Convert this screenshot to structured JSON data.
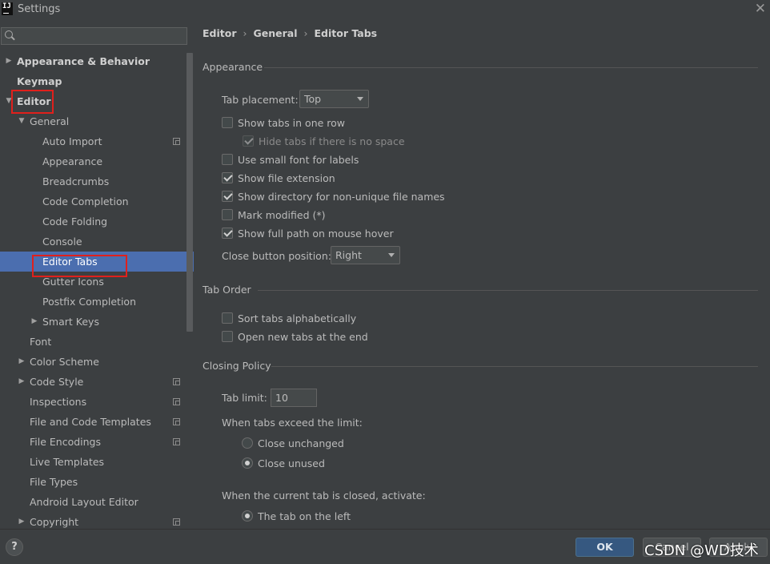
{
  "window": {
    "title": "Settings",
    "logo": "IJ"
  },
  "search": {
    "placeholder": "",
    "value": ""
  },
  "sidebar": {
    "items": [
      {
        "label": "Appearance & Behavior",
        "level": 0,
        "arrow": "▶",
        "bold": true
      },
      {
        "label": "Keymap",
        "level": 0,
        "arrow": "",
        "bold": true
      },
      {
        "label": "Editor",
        "level": 0,
        "arrow": "▼",
        "bold": true
      },
      {
        "label": "General",
        "level": 1,
        "arrow": "▼"
      },
      {
        "label": "Auto Import",
        "level": 2,
        "arrow": "",
        "copy_icon": true
      },
      {
        "label": "Appearance",
        "level": 2,
        "arrow": ""
      },
      {
        "label": "Breadcrumbs",
        "level": 2,
        "arrow": ""
      },
      {
        "label": "Code Completion",
        "level": 2,
        "arrow": ""
      },
      {
        "label": "Code Folding",
        "level": 2,
        "arrow": ""
      },
      {
        "label": "Console",
        "level": 2,
        "arrow": ""
      },
      {
        "label": "Editor Tabs",
        "level": 2,
        "arrow": "",
        "selected": true
      },
      {
        "label": "Gutter Icons",
        "level": 2,
        "arrow": ""
      },
      {
        "label": "Postfix Completion",
        "level": 2,
        "arrow": ""
      },
      {
        "label": "Smart Keys",
        "level": 2,
        "arrow": "▶"
      },
      {
        "label": "Font",
        "level": 1,
        "arrow": ""
      },
      {
        "label": "Color Scheme",
        "level": 1,
        "arrow": "▶"
      },
      {
        "label": "Code Style",
        "level": 1,
        "arrow": "▶",
        "copy_icon": true
      },
      {
        "label": "Inspections",
        "level": 1,
        "arrow": "",
        "copy_icon": true
      },
      {
        "label": "File and Code Templates",
        "level": 1,
        "arrow": "",
        "copy_icon": true
      },
      {
        "label": "File Encodings",
        "level": 1,
        "arrow": "",
        "copy_icon": true
      },
      {
        "label": "Live Templates",
        "level": 1,
        "arrow": ""
      },
      {
        "label": "File Types",
        "level": 1,
        "arrow": ""
      },
      {
        "label": "Android Layout Editor",
        "level": 1,
        "arrow": ""
      },
      {
        "label": "Copyright",
        "level": 1,
        "arrow": "▶",
        "copy_icon": true
      }
    ]
  },
  "breadcrumb": [
    "Editor",
    "General",
    "Editor Tabs"
  ],
  "breadcrumb_separator": "›",
  "appearance": {
    "title": "Appearance",
    "tab_placement_label": "Tab placement:",
    "tab_placement_value": "Top",
    "show_tabs_one_row": {
      "label": "Show tabs in one row",
      "checked": false
    },
    "hide_tabs_no_space": {
      "label": "Hide tabs if there is no space",
      "checked": true,
      "disabled": true
    },
    "small_font": {
      "label": "Use small font for labels",
      "checked": false
    },
    "show_extension": {
      "label": "Show file extension",
      "checked": true
    },
    "show_directory": {
      "label": "Show directory for non-unique file names",
      "checked": true
    },
    "mark_modified": {
      "label": "Mark modified (*)",
      "checked": false
    },
    "full_path_hover": {
      "label": "Show full path on mouse hover",
      "checked": true
    },
    "close_button_label": "Close button position:",
    "close_button_value": "Right"
  },
  "tab_order": {
    "title": "Tab Order",
    "sort_alpha": {
      "label": "Sort tabs alphabetically",
      "checked": false
    },
    "open_at_end": {
      "label": "Open new tabs at the end",
      "checked": false
    }
  },
  "closing_policy": {
    "title": "Closing Policy",
    "tab_limit_label": "Tab limit:",
    "tab_limit_value": "10",
    "exceed_label": "When tabs exceed the limit:",
    "close_unchanged": {
      "label": "Close unchanged",
      "selected": false
    },
    "close_unused": {
      "label": "Close unused",
      "selected": true
    },
    "activate_label": "When the current tab is closed, activate:",
    "tab_on_left": {
      "label": "The tab on the left",
      "selected": true
    }
  },
  "footer": {
    "help_label": "?",
    "ok_label": "OK",
    "cancel_label": "Cancel",
    "apply_label": "Apply",
    "watermark": "CSDN @WD技术"
  },
  "colors": {
    "background": "#3c3f41",
    "selection": "#4b6eaf",
    "ok_button": "#365880",
    "annotation_red": "#e0201c"
  }
}
